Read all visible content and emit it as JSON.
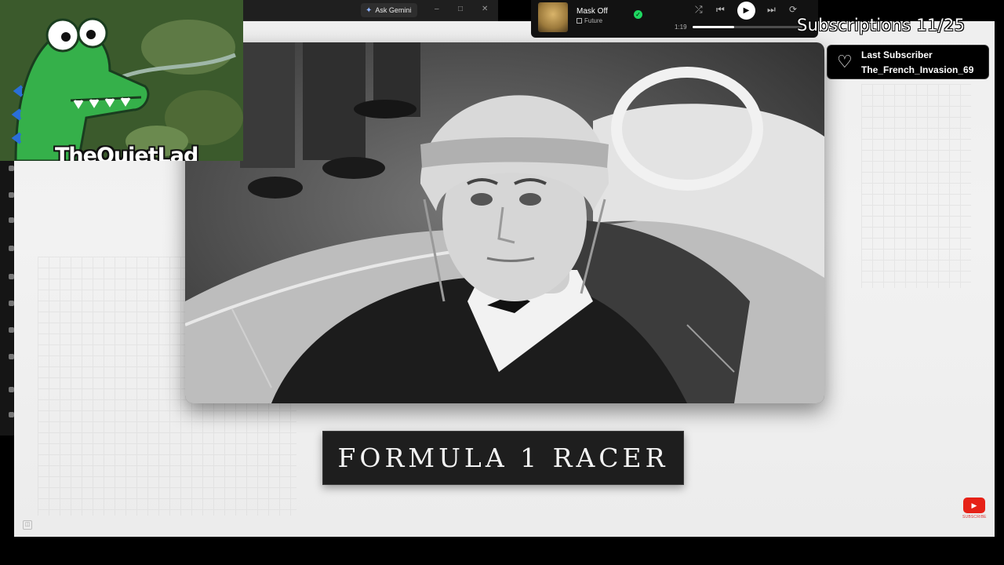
{
  "host_window": {
    "ask_gemini_label": "Ask Gemini",
    "minimize_glyph": "–",
    "maximize_glyph": "□",
    "close_glyph": "✕"
  },
  "stream_overlay": {
    "channel_name": "TheQuietLad",
    "subscriptions_goal": "Subscriptions 11/25",
    "last_subscriber_label": "Last Subscriber",
    "last_subscriber_name": "The_French_Invasion_69"
  },
  "music_player": {
    "track_title": "Mask Off",
    "artist": "Future",
    "elapsed": "1:19",
    "progress_fraction": 0.38,
    "accent_color": "#1ed760"
  },
  "video": {
    "title_card": "FORMULA 1 RACER",
    "photo_subject": "black-and-white photo of a racing driver in a helmet seated in a race car"
  },
  "icons": {
    "heart": "heart-icon",
    "shuffle": "shuffle-icon",
    "previous": "previous-icon",
    "play": "play-icon",
    "next": "next-icon",
    "repeat": "repeat-icon",
    "youtube": "youtube-subscribe-icon"
  },
  "watermark": {
    "subscribe_caption": "SUBSCRIBE"
  }
}
